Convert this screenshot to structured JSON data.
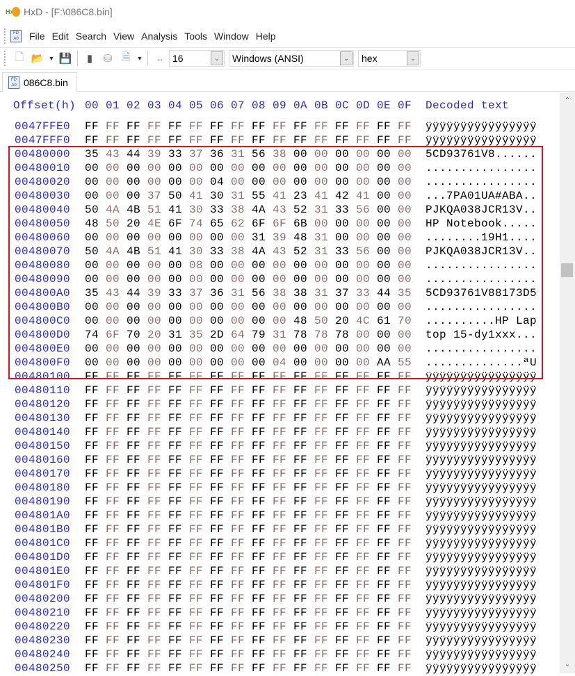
{
  "window": {
    "title": "HxD - [F:\\086C8.bin]"
  },
  "menu": [
    "File",
    "Edit",
    "Search",
    "View",
    "Analysis",
    "Tools",
    "Window",
    "Help"
  ],
  "toolbar": {
    "bytes_per_row": "16",
    "charset": "Windows (ANSI)",
    "offset_base": "hex"
  },
  "tab": {
    "label": "086C8.bin"
  },
  "header": {
    "offset": "Offset(h)",
    "columns": [
      "00",
      "01",
      "02",
      "03",
      "04",
      "05",
      "06",
      "07",
      "08",
      "09",
      "0A",
      "0B",
      "0C",
      "0D",
      "0E",
      "0F"
    ],
    "decoded": "Decoded text"
  },
  "rows": [
    {
      "offset": "0047FFE0",
      "hex": "FF FF FF FF FF FF FF FF FF FF FF FF FF FF FF FF",
      "text": "ÿÿÿÿÿÿÿÿÿÿÿÿÿÿÿÿ"
    },
    {
      "offset": "0047FFF0",
      "hex": "FF FF FF FF FF FF FF FF FF FF FF FF FF FF FF FF",
      "text": "ÿÿÿÿÿÿÿÿÿÿÿÿÿÿÿÿ"
    },
    {
      "offset": "00480000",
      "hex": "35 43 44 39 33 37 36 31 56 38 00 00 00 00 00 00",
      "text": "5CD93761V8......"
    },
    {
      "offset": "00480010",
      "hex": "00 00 00 00 00 00 00 00 00 00 00 00 00 00 00 00",
      "text": "................"
    },
    {
      "offset": "00480020",
      "hex": "00 00 00 00 00 00 04 00 00 00 00 00 00 00 00 00",
      "text": "................"
    },
    {
      "offset": "00480030",
      "hex": "00 00 00 37 50 41 30 31 55 41 23 41 42 41 00 00",
      "text": "...7PA01UA#ABA.."
    },
    {
      "offset": "00480040",
      "hex": "50 4A 4B 51 41 30 33 38 4A 43 52 31 33 56 00 00",
      "text": "PJKQA038JCR13V.."
    },
    {
      "offset": "00480050",
      "hex": "48 50 20 4E 6F 74 65 62 6F 6F 6B 00 00 00 00 00",
      "text": "HP Notebook....."
    },
    {
      "offset": "00480060",
      "hex": "00 00 00 00 00 00 00 00 31 39 48 31 00 00 00 00",
      "text": "........19H1...."
    },
    {
      "offset": "00480070",
      "hex": "50 4A 4B 51 41 30 33 38 4A 43 52 31 33 56 00 00",
      "text": "PJKQA038JCR13V.."
    },
    {
      "offset": "00480080",
      "hex": "00 00 00 00 00 08 00 00 00 00 00 00 00 00 00 00",
      "text": "................"
    },
    {
      "offset": "00480090",
      "hex": "00 00 00 00 00 00 00 00 00 00 00 00 00 00 00 00",
      "text": "................"
    },
    {
      "offset": "004800A0",
      "hex": "35 43 44 39 33 37 36 31 56 38 38 31 37 33 44 35",
      "text": "5CD93761V88173D5"
    },
    {
      "offset": "004800B0",
      "hex": "00 00 00 00 00 00 00 00 00 00 00 00 00 00 00 00",
      "text": "................"
    },
    {
      "offset": "004800C0",
      "hex": "00 00 00 00 00 00 00 00 00 00 48 50 20 4C 61 70",
      "text": "..........HP Lap"
    },
    {
      "offset": "004800D0",
      "hex": "74 6F 70 20 31 35 2D 64 79 31 78 78 78 00 00 00",
      "text": "top 15-dy1xxx..."
    },
    {
      "offset": "004800E0",
      "hex": "00 00 00 00 00 00 00 00 00 00 00 00 00 00 00 00",
      "text": "................"
    },
    {
      "offset": "004800F0",
      "hex": "00 00 00 00 00 00 00 00 00 04 00 00 00 00 AA 55",
      "text": "..............ªU"
    },
    {
      "offset": "00480100",
      "hex": "FF FF FF FF FF FF FF FF FF FF FF FF FF FF FF FF",
      "text": "ÿÿÿÿÿÿÿÿÿÿÿÿÿÿÿÿ"
    },
    {
      "offset": "00480110",
      "hex": "FF FF FF FF FF FF FF FF FF FF FF FF FF FF FF FF",
      "text": "ÿÿÿÿÿÿÿÿÿÿÿÿÿÿÿÿ"
    },
    {
      "offset": "00480120",
      "hex": "FF FF FF FF FF FF FF FF FF FF FF FF FF FF FF FF",
      "text": "ÿÿÿÿÿÿÿÿÿÿÿÿÿÿÿÿ"
    },
    {
      "offset": "00480130",
      "hex": "FF FF FF FF FF FF FF FF FF FF FF FF FF FF FF FF",
      "text": "ÿÿÿÿÿÿÿÿÿÿÿÿÿÿÿÿ"
    },
    {
      "offset": "00480140",
      "hex": "FF FF FF FF FF FF FF FF FF FF FF FF FF FF FF FF",
      "text": "ÿÿÿÿÿÿÿÿÿÿÿÿÿÿÿÿ"
    },
    {
      "offset": "00480150",
      "hex": "FF FF FF FF FF FF FF FF FF FF FF FF FF FF FF FF",
      "text": "ÿÿÿÿÿÿÿÿÿÿÿÿÿÿÿÿ"
    },
    {
      "offset": "00480160",
      "hex": "FF FF FF FF FF FF FF FF FF FF FF FF FF FF FF FF",
      "text": "ÿÿÿÿÿÿÿÿÿÿÿÿÿÿÿÿ"
    },
    {
      "offset": "00480170",
      "hex": "FF FF FF FF FF FF FF FF FF FF FF FF FF FF FF FF",
      "text": "ÿÿÿÿÿÿÿÿÿÿÿÿÿÿÿÿ"
    },
    {
      "offset": "00480180",
      "hex": "FF FF FF FF FF FF FF FF FF FF FF FF FF FF FF FF",
      "text": "ÿÿÿÿÿÿÿÿÿÿÿÿÿÿÿÿ"
    },
    {
      "offset": "00480190",
      "hex": "FF FF FF FF FF FF FF FF FF FF FF FF FF FF FF FF",
      "text": "ÿÿÿÿÿÿÿÿÿÿÿÿÿÿÿÿ"
    },
    {
      "offset": "004801A0",
      "hex": "FF FF FF FF FF FF FF FF FF FF FF FF FF FF FF FF",
      "text": "ÿÿÿÿÿÿÿÿÿÿÿÿÿÿÿÿ"
    },
    {
      "offset": "004801B0",
      "hex": "FF FF FF FF FF FF FF FF FF FF FF FF FF FF FF FF",
      "text": "ÿÿÿÿÿÿÿÿÿÿÿÿÿÿÿÿ"
    },
    {
      "offset": "004801C0",
      "hex": "FF FF FF FF FF FF FF FF FF FF FF FF FF FF FF FF",
      "text": "ÿÿÿÿÿÿÿÿÿÿÿÿÿÿÿÿ"
    },
    {
      "offset": "004801D0",
      "hex": "FF FF FF FF FF FF FF FF FF FF FF FF FF FF FF FF",
      "text": "ÿÿÿÿÿÿÿÿÿÿÿÿÿÿÿÿ"
    },
    {
      "offset": "004801E0",
      "hex": "FF FF FF FF FF FF FF FF FF FF FF FF FF FF FF FF",
      "text": "ÿÿÿÿÿÿÿÿÿÿÿÿÿÿÿÿ"
    },
    {
      "offset": "004801F0",
      "hex": "FF FF FF FF FF FF FF FF FF FF FF FF FF FF FF FF",
      "text": "ÿÿÿÿÿÿÿÿÿÿÿÿÿÿÿÿ"
    },
    {
      "offset": "00480200",
      "hex": "FF FF FF FF FF FF FF FF FF FF FF FF FF FF FF FF",
      "text": "ÿÿÿÿÿÿÿÿÿÿÿÿÿÿÿÿ"
    },
    {
      "offset": "00480210",
      "hex": "FF FF FF FF FF FF FF FF FF FF FF FF FF FF FF FF",
      "text": "ÿÿÿÿÿÿÿÿÿÿÿÿÿÿÿÿ"
    },
    {
      "offset": "00480220",
      "hex": "FF FF FF FF FF FF FF FF FF FF FF FF FF FF FF FF",
      "text": "ÿÿÿÿÿÿÿÿÿÿÿÿÿÿÿÿ"
    },
    {
      "offset": "00480230",
      "hex": "FF FF FF FF FF FF FF FF FF FF FF FF FF FF FF FF",
      "text": "ÿÿÿÿÿÿÿÿÿÿÿÿÿÿÿÿ"
    },
    {
      "offset": "00480240",
      "hex": "FF FF FF FF FF FF FF FF FF FF FF FF FF FF FF FF",
      "text": "ÿÿÿÿÿÿÿÿÿÿÿÿÿÿÿÿ"
    },
    {
      "offset": "00480250",
      "hex": "FF FF FF FF FF FF FF FF FF FF FF FF FF FF FF FF",
      "text": "ÿÿÿÿÿÿÿÿÿÿÿÿÿÿÿÿ"
    }
  ],
  "colors": {
    "offset": "#2a2ad0",
    "even_byte": "#000000",
    "odd_byte": "#8a6e6e",
    "highlight_box": "#e01020"
  },
  "scrollbar": {
    "position_fraction": 0.29
  }
}
